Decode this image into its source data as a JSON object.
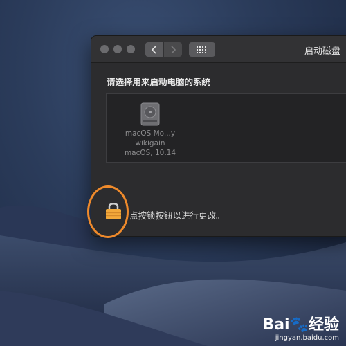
{
  "window": {
    "title": "启动磁盘",
    "prompt": "请选择用来启动电脑的系统",
    "lock_message": "点按锁按钮以进行更改。"
  },
  "toolbar": {
    "back_icon": "chevron-left-icon",
    "forward_icon": "chevron-right-icon",
    "grid_icon": "grid-icon"
  },
  "disks": [
    {
      "name": "macOS Mo...y wikigain",
      "version": "macOS, 10.14",
      "icon": "hard-drive-icon"
    }
  ],
  "annotation": {
    "color": "#ef8a2b"
  },
  "watermark": {
    "brand_left": "Bai",
    "brand_right": "经验",
    "url": "jingyan.baidu.com"
  },
  "colors": {
    "lock": "#f2a93b",
    "window_bg": "#2c2c2e"
  }
}
